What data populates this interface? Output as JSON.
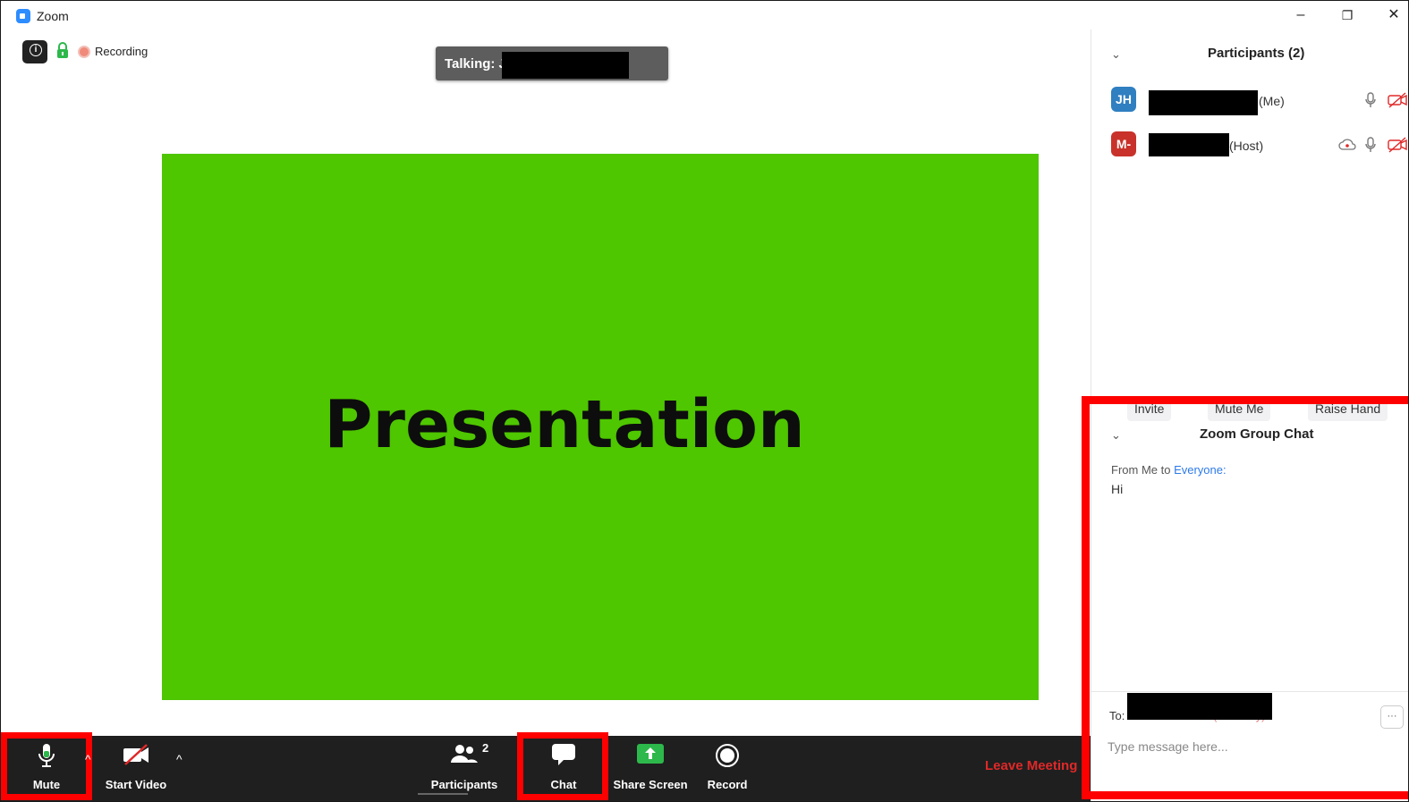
{
  "window": {
    "title": "Zoom",
    "minimize": "–",
    "restore": "❐",
    "close": "✕"
  },
  "meeting": {
    "recording_label": "Recording",
    "talking_label": "Talking: J",
    "slide_text": "Presentation"
  },
  "toolbar": {
    "mute_label": "Mute",
    "video_label": "Start Video",
    "participants_label": "Participants",
    "participants_count": "2",
    "chat_label": "Chat",
    "share_label": "Share Screen",
    "record_label": "Record",
    "leave_label": "Leave Meeting"
  },
  "participants": {
    "title": "Participants (2)",
    "list": [
      {
        "initials": "JH",
        "suffix": "(Me)",
        "color": "#2f7fc1"
      },
      {
        "initials": "M-",
        "suffix": "(Host)",
        "color": "#c8322a"
      }
    ],
    "invite_label": "Invite",
    "muteme_label": "Mute Me",
    "raisehand_label": "Raise Hand"
  },
  "chat": {
    "title": "Zoom Group Chat",
    "from_prefix": "From Me to ",
    "from_target": "Everyone:",
    "message": "Hi",
    "to_label": "To:",
    "to_private": "(Privately)",
    "more_label": "···",
    "input_placeholder": "Type message here..."
  },
  "colors": {
    "slide_bg": "#4ec600",
    "highlight": "#ff0000",
    "leave": "#e02828",
    "share_green": "#2db84b"
  }
}
